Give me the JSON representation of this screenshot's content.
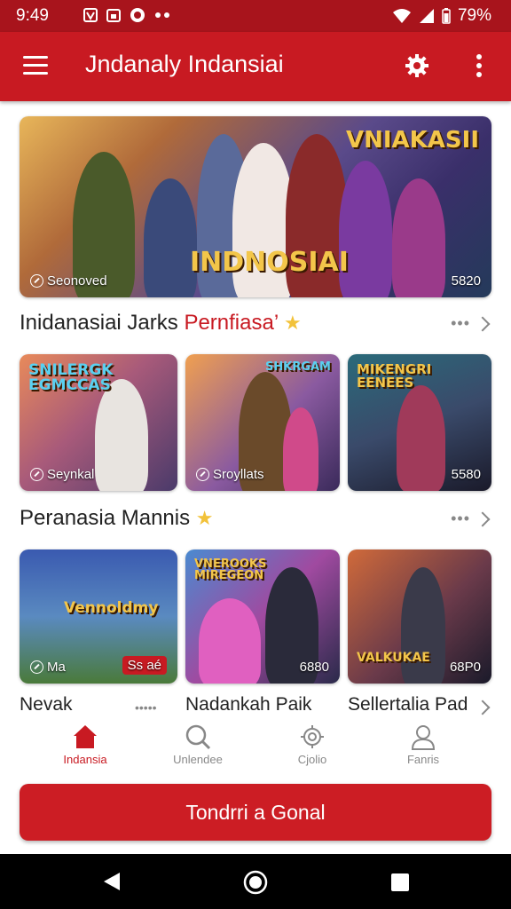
{
  "status": {
    "time": "9:49",
    "battery": "79%"
  },
  "appbar": {
    "title": "Jndanaly Indansiai"
  },
  "hero": {
    "art_title": "VNIAKASII",
    "art_sub": "INDNOSIAI",
    "caption": "Seonoved",
    "count": "5820"
  },
  "section1": {
    "title_dark": "Inidanasiai Jarks",
    "title_red": "Pernfiasa’",
    "more": "•••"
  },
  "row1": [
    {
      "art": "SNILERGK EGMCCAS",
      "caption": "Seynkal",
      "count": ""
    },
    {
      "art": "SHKRGAM",
      "caption": "Sroyllats",
      "count": ""
    },
    {
      "art": "MIKENGRI EENEES",
      "caption": "",
      "count": "5580"
    }
  ],
  "section2": {
    "title": "Peranasia Mannis",
    "more": "•••"
  },
  "row2": [
    {
      "art": "Vennoldmy",
      "caption": "Ma",
      "count": "Ss aé"
    },
    {
      "art": "VNEROOKS MIREGEON",
      "caption": "",
      "count": "6880"
    },
    {
      "art": "VALKUKAE",
      "caption": "",
      "count": "68P0"
    }
  ],
  "labels": [
    {
      "text": "Nevak",
      "more": "•••••"
    },
    {
      "text": "Nadankah Paik"
    },
    {
      "text": "Sellertalia Pad"
    }
  ],
  "tabs": [
    {
      "label": "Indansia"
    },
    {
      "label": "Unlendee"
    },
    {
      "label": "Cjolio"
    },
    {
      "label": "Fanris"
    }
  ],
  "cta": {
    "label": "Tondrri a Gonal"
  }
}
